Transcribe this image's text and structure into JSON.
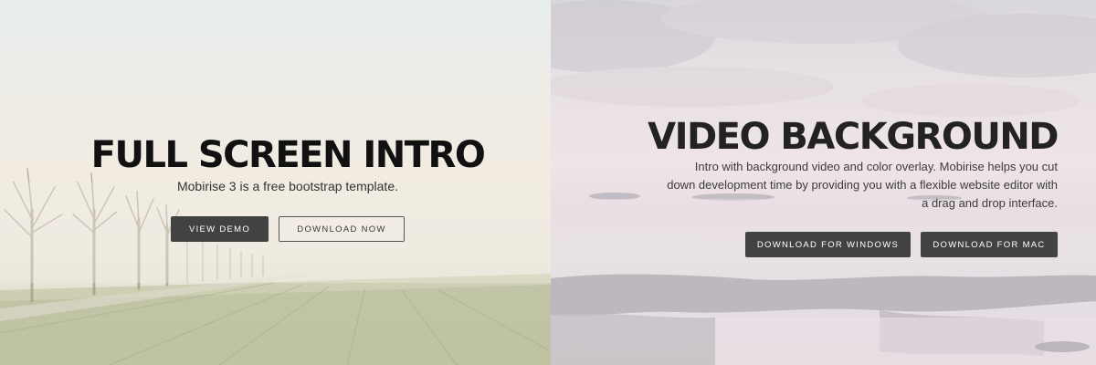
{
  "left_panel": {
    "title": "FULL SCREEN INTRO",
    "subtitle": "Mobirise 3 is a free bootstrap template.",
    "buttons": {
      "view_demo": "VIEW DEMO",
      "download_now": "DOWNLOAD NOW"
    },
    "background": "misty-field-with-trees-image"
  },
  "right_panel": {
    "title": "VIDEO BACKGROUND",
    "description": "Intro with background video and color overlay. Mobirise helps you cut down development time by providing you with a flexible website editor with a drag and drop interface.",
    "buttons": {
      "download_windows": "DOWNLOAD FOR WINDOWS",
      "download_mac": "DOWNLOAD FOR MAC"
    },
    "background": "sunset-sea-rocks-video-frame"
  },
  "colors": {
    "button_dark": "#424242",
    "title_text": "#111111"
  }
}
